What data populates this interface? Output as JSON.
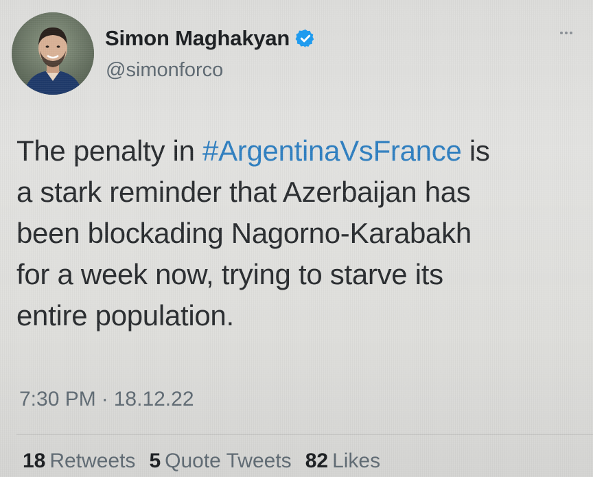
{
  "author": {
    "display_name": "Simon Maghakyan",
    "handle": "@simonforco",
    "verified_icon": "verified-badge-icon",
    "verified_color": "#1d9bf0"
  },
  "menu_icon": "more-horizontal-icon",
  "tweet": {
    "lines": [
      {
        "before": "The penalty in ",
        "hashtag": "#ArgentinaVsFrance",
        "after": " is"
      },
      {
        "text": "a stark reminder that Azerbaijan has"
      },
      {
        "text": "been blockading Nagorno-Karabakh"
      },
      {
        "text": "for a week now, trying to starve its"
      },
      {
        "text": "entire population."
      }
    ],
    "hashtag_color": "#2f7fc0"
  },
  "meta": {
    "time": "7:30 PM",
    "separator": "·",
    "date": "18.12.22"
  },
  "stats": {
    "retweets_count": "18",
    "retweets_label": "Retweets",
    "quotes_count": "5",
    "quotes_label": "Quote Tweets",
    "likes_count": "82",
    "likes_label": "Likes"
  }
}
